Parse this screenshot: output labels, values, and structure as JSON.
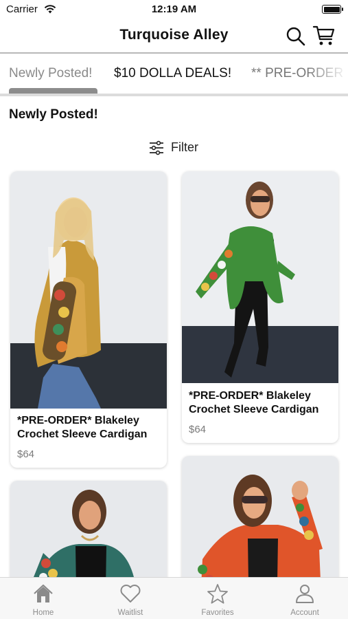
{
  "status_bar": {
    "carrier": "Carrier",
    "time": "12:19 AM"
  },
  "header": {
    "title": "Turquoise Alley"
  },
  "tabs": [
    {
      "label": "Newly Posted!",
      "selected": true
    },
    {
      "label": "$10 DOLLA DEALS!"
    },
    {
      "label": "** PRE-ORDER"
    }
  ],
  "section_title": "Newly Posted!",
  "filter_label": "Filter",
  "products": [
    {
      "name": "*PRE-ORDER* Blakeley Crochet Sleeve Cardigan",
      "price": "$64",
      "cardigan_color": "#c99a3a"
    },
    {
      "name": "*PRE-ORDER* Blakeley Crochet Sleeve Cardigan",
      "price": "$64",
      "cardigan_color": "#3f8f3a"
    },
    {
      "name": "",
      "price": "",
      "cardigan_color": "#2f6f66"
    },
    {
      "name": "",
      "price": "",
      "cardigan_color": "#e0552a"
    }
  ],
  "tab_bar": [
    {
      "label": "Home",
      "icon": "home-icon",
      "active": true
    },
    {
      "label": "Waitlist",
      "icon": "heart-icon"
    },
    {
      "label": "Favorites",
      "icon": "star-icon"
    },
    {
      "label": "Account",
      "icon": "person-icon"
    }
  ]
}
